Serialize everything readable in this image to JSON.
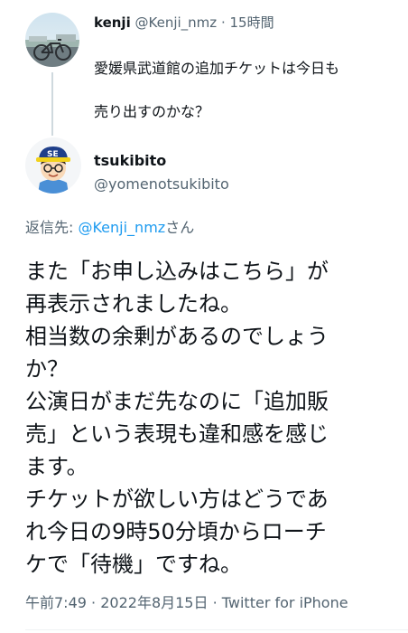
{
  "parent_tweet": {
    "name": "kenji",
    "handle": "@Kenji_nmz",
    "separator": "·",
    "time": "15時間",
    "text_lines": [
      "愛媛県武道館の追加チケットは今日も",
      "売り出すのかな？"
    ],
    "avatar_icon": "bicycle-photo-avatar"
  },
  "main_tweet": {
    "name": "tsukibito",
    "handle": "@yomenotsukibito",
    "avatar_icon": "cartoon-person-cap-avatar",
    "reply_prefix": "返信先: ",
    "reply_mention": "@Kenji_nmz",
    "reply_suffix": "さん",
    "body_lines": [
      "また「お申し込みはこちら」が",
      "再表示されましたね。",
      "相当数の余剰があるのでしょう",
      "か？",
      "公演日がまだ先なのに「追加販",
      "売」という表現も違和感を感じ",
      "ます。",
      "チケットが欲しい方はどうであ",
      "れ今日の9時50分頃からローチ",
      "ケで「待機」ですね。"
    ],
    "time": "午前7:49",
    "date": "2022年8月15日",
    "separator": "·",
    "source": "Twitter for iPhone"
  },
  "colors": {
    "text_primary": "#0f1419",
    "text_secondary": "#536471",
    "link": "#1d9bf0",
    "thread_line": "#cfd9de"
  }
}
